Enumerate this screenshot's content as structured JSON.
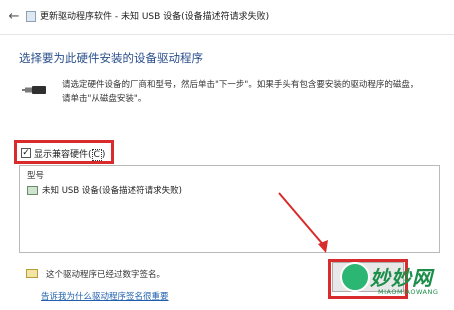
{
  "window": {
    "title": "更新驱动程序软件 - 未知 USB 设备(设备描述符请求失败)",
    "back_glyph": "←"
  },
  "main": {
    "heading": "选择要为此硬件安装的设备驱动程序",
    "description_line1": "请选定硬件设备的厂商和型号，然后单击\"下一步\"。如果手头有包含要安装的驱动程序的磁盘，",
    "description_line2": "请单击\"从磁盘安装\"。"
  },
  "compat": {
    "checked_glyph": "✓",
    "label": "显示兼容硬件",
    "hotkey": "C",
    "open_paren": "(",
    "close_paren": ")",
    "checked": true
  },
  "model_list": {
    "header": "型号",
    "items": [
      {
        "label": "未知 USB 设备(设备描述符请求失败)"
      }
    ]
  },
  "signature": {
    "text": "这个驱动程序已经过数字签名。",
    "link": "告诉我为什么驱动程序签名很重要"
  },
  "watermark": {
    "title": "妙妙网",
    "subtitle": "MIAOMIAOWANG"
  },
  "colors": {
    "highlight": "#d92b2b",
    "heading": "#2a4f8c",
    "link": "#1f5fae"
  },
  "icons": [
    "back-arrow-icon",
    "device-manager-icon",
    "usb-plug-icon",
    "usb-device-icon",
    "certificate-icon"
  ]
}
